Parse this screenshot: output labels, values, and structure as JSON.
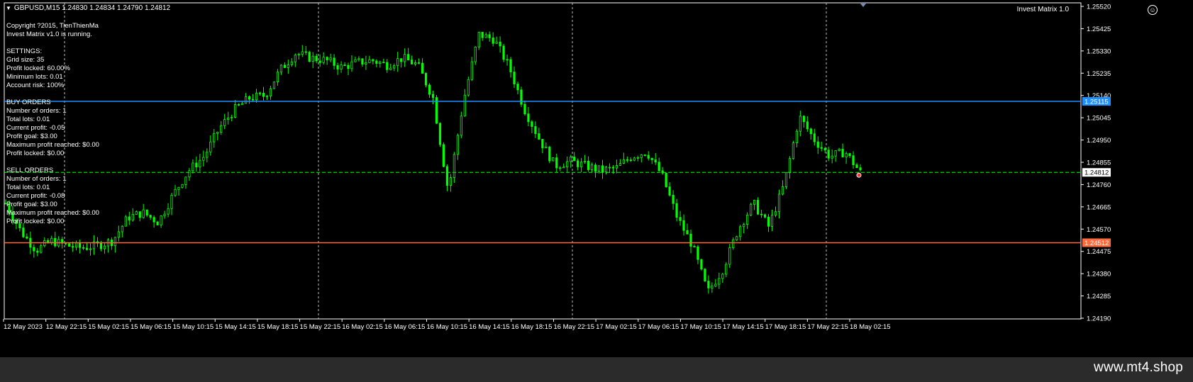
{
  "chart": {
    "symbol_line": "GBPUSD,M15  1.24830 1.24834 1.24790 1.24812",
    "ea_name": "Invest Matrix 1.0",
    "colors": {
      "background": "#000000",
      "candle": "#00ff00",
      "grid": "#c0c0c0",
      "buy_line": "#1e90ff",
      "sell_line": "#ff6a3d",
      "bid_line": "#00ff00",
      "axis_text": "#ffffff"
    }
  },
  "info_lines": [
    "Copyright ?2015, TienThienMa",
    "Invest Matrix v1.0 is running.",
    "",
    "SETTINGS:",
    "Grid size: 35",
    "Profit locked: 60.00%",
    "Minimum lots: 0.01",
    "Account risk: 100%",
    "",
    "BUY ORDERS",
    "Number of orders: 1",
    "Total lots: 0.01",
    "Current profit: -0.05",
    "Profit goal: $3.00",
    "Maximum profit reached: $0.00",
    "Profit locked: $0.00",
    "",
    "SELL ORDERS",
    "Number of orders: 1",
    "Total lots: 0.01",
    "Current profit: -0.08",
    "Profit goal: $3.00",
    "Maximum profit reached: $0.00",
    "Profit locked: $0.00"
  ],
  "price_axis": {
    "ticks": [
      "1.25520",
      "1.25425",
      "1.25330",
      "1.25235",
      "1.25140",
      "1.25045",
      "1.24950",
      "1.24855",
      "1.24760",
      "1.24665",
      "1.24570",
      "1.24475",
      "1.24380",
      "1.24285",
      "1.24190"
    ],
    "markers": [
      {
        "label": "1.25115",
        "value": 1.25115,
        "color": "#1e90ff"
      },
      {
        "label": "1.24812",
        "value": 1.24812,
        "color": "#ffffff"
      },
      {
        "label": "1.24512",
        "value": 1.24512,
        "color": "#ff6a3d"
      }
    ]
  },
  "time_axis": {
    "labels": [
      "12 May 2023",
      "12 May 22:15",
      "15 May 02:15",
      "15 May 06:15",
      "15 May 10:15",
      "15 May 14:15",
      "15 May 18:15",
      "15 May 22:15",
      "16 May 02:15",
      "16 May 06:15",
      "16 May 10:15",
      "16 May 14:15",
      "16 May 18:15",
      "16 May 22:15",
      "17 May 02:15",
      "17 May 06:15",
      "17 May 10:15",
      "17 May 14:15",
      "17 May 18:15",
      "17 May 22:15",
      "18 May 02:15"
    ]
  },
  "chart_data": {
    "type": "candlestick",
    "series_close_path": [
      1.2468,
      1.2456,
      1.2448,
      1.2452,
      1.245,
      1.2449,
      1.245,
      1.2452,
      1.2462,
      1.2464,
      1.246,
      1.2472,
      1.2482,
      1.2488,
      1.25,
      1.2508,
      1.2513,
      1.2514,
      1.2525,
      1.2532,
      1.253,
      1.2529,
      1.2526,
      1.2528,
      1.2529,
      1.2527,
      1.253,
      1.2527,
      1.2513,
      1.2473,
      1.2512,
      1.254,
      1.2538,
      1.2526,
      1.2508,
      1.2495,
      1.2484,
      1.2486,
      1.2484,
      1.2482,
      1.2483,
      1.2488,
      1.249,
      1.248,
      1.2462,
      1.245,
      1.243,
      1.244,
      1.2457,
      1.2468,
      1.2458,
      1.2476,
      1.2505,
      1.2495,
      1.2488,
      1.249,
      1.24812
    ]
  },
  "watermark": "www.mt4.shop"
}
